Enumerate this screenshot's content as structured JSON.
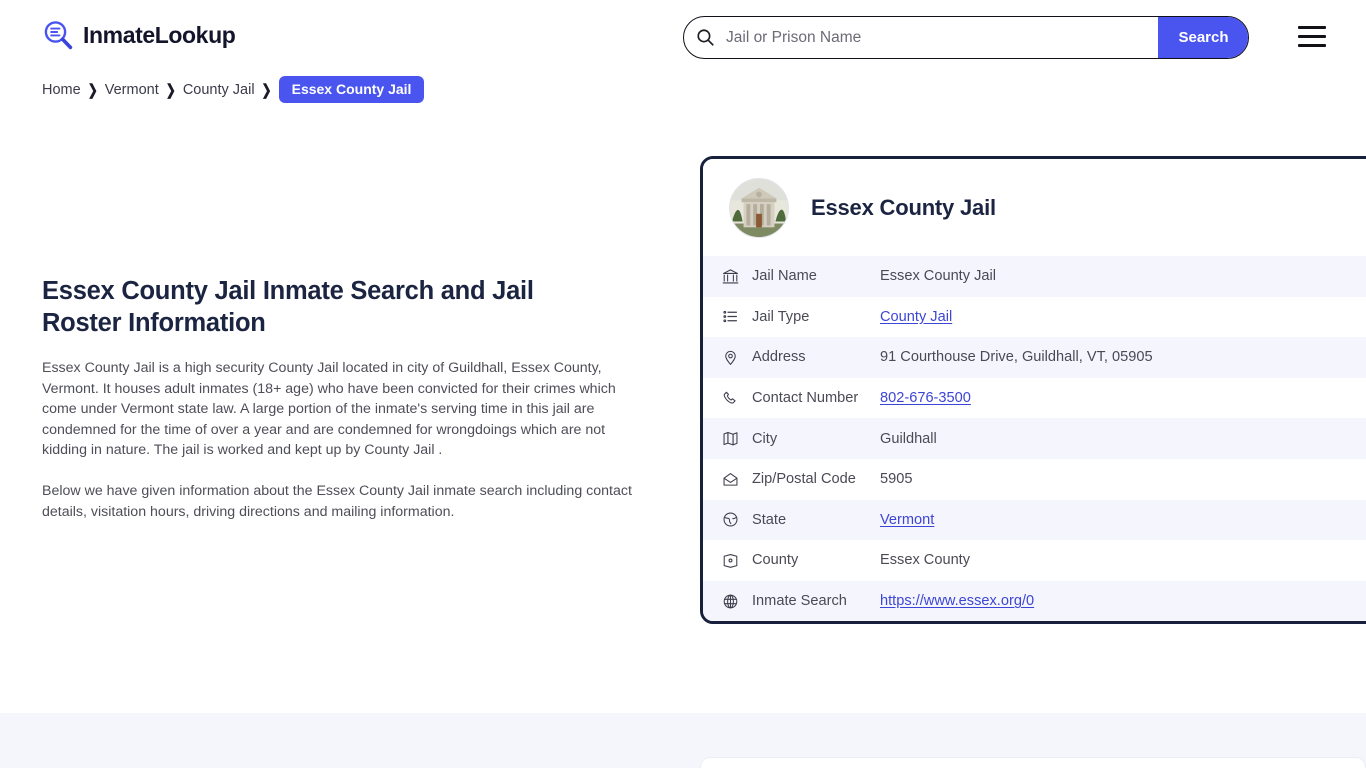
{
  "brand": {
    "name": "InmateLookup",
    "icon": "magnifier-list-icon"
  },
  "search": {
    "placeholder": "Jail or Prison Name",
    "value": "",
    "button_label": "Search",
    "icon": "search-icon"
  },
  "menu": {
    "icon": "hamburger-icon"
  },
  "breadcrumb": {
    "items": [
      {
        "label": "Home",
        "current": false
      },
      {
        "label": "Vermont",
        "current": false
      },
      {
        "label": "County Jail",
        "current": false
      },
      {
        "label": "Essex County Jail",
        "current": true
      }
    ],
    "separator": "❯"
  },
  "main": {
    "title": "Essex County Jail Inmate Search and Jail Roster Information",
    "paragraph_1": "Essex County Jail is a high security County Jail located in city of Guildhall, Essex County, Vermont. It houses adult inmates (18+ age) who have been convicted for their crimes which come under Vermont state law. A large portion of the inmate's serving time in this jail are condemned for the time of over a year and are condemned for wrongdoings which are not kidding in nature. The jail is worked and kept up by County Jail .",
    "paragraph_2": "Below we have given information about the Essex County Jail inmate search including contact details, visitation hours, driving directions and mailing information."
  },
  "card": {
    "title": "Essex County Jail",
    "thumbnail_alt": "courthouse-photo",
    "rows": [
      {
        "icon": "bank-icon",
        "label": "Jail Name",
        "value": "Essex County Jail",
        "link": false
      },
      {
        "icon": "list-icon",
        "label": "Jail Type",
        "value": "County Jail",
        "link": true
      },
      {
        "icon": "map-pin-icon",
        "label": "Address",
        "value": "91 Courthouse Drive, Guildhall, VT, 05905",
        "link": false
      },
      {
        "icon": "phone-icon",
        "label": "Contact Number",
        "value": "802-676-3500",
        "link": true
      },
      {
        "icon": "map-icon",
        "label": "City",
        "value": "Guildhall",
        "link": false
      },
      {
        "icon": "envelope-icon",
        "label": "Zip/Postal Code",
        "value": "5905",
        "link": false
      },
      {
        "icon": "globe-solid-icon",
        "label": "State",
        "value": "Vermont",
        "link": true
      },
      {
        "icon": "map-marked-icon",
        "label": "County",
        "value": "Essex County",
        "link": false
      },
      {
        "icon": "globe-grid-icon",
        "label": "Inmate Search",
        "value": "https://www.essex.org/0",
        "link": true
      }
    ]
  },
  "colors": {
    "accent": "#4a54ef",
    "link": "#3d45d6",
    "card_border": "#17203c",
    "row_alt": "#f5f6fd",
    "band": "#f5f5fc",
    "title": "#1b2441",
    "body_text": "#4e4e58"
  }
}
